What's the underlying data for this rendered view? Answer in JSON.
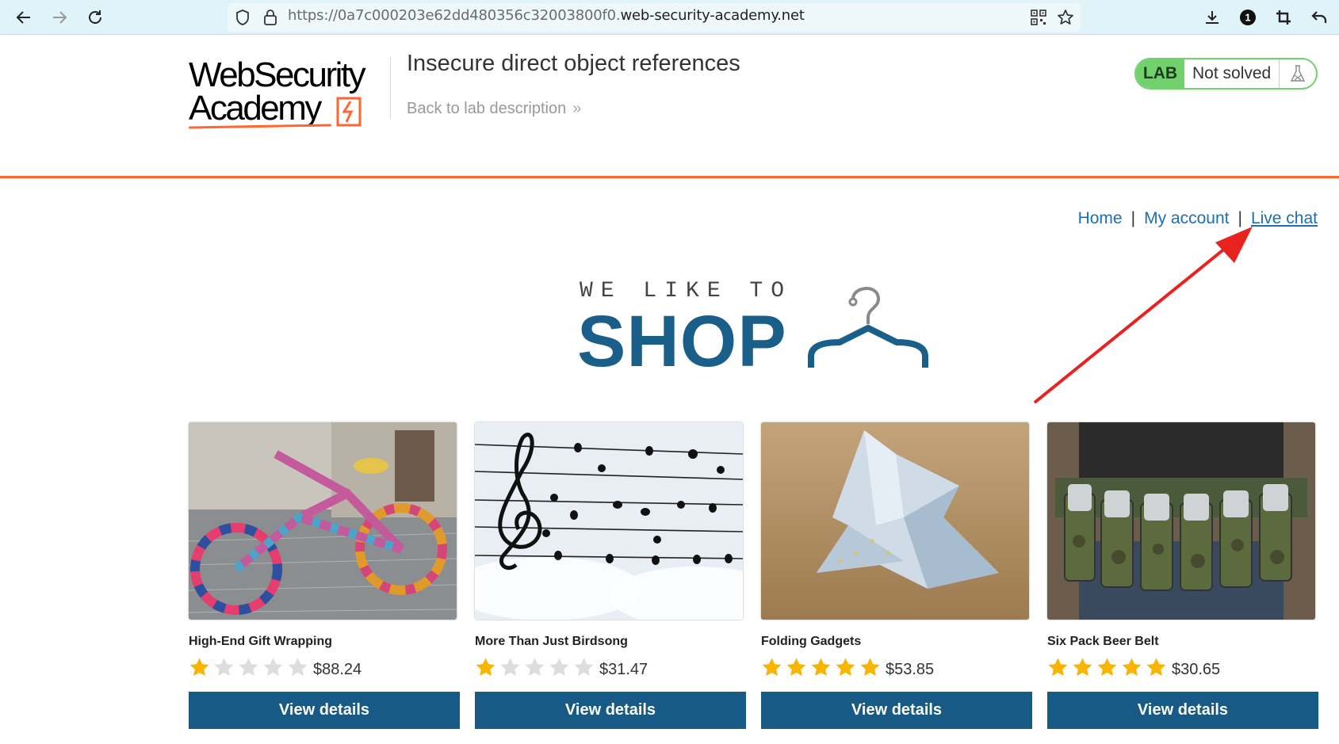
{
  "browser": {
    "url_prefix": "https://0a7c000203e62dd480356c32003800f0.",
    "url_domain": "web-security-academy.net",
    "notification_count": "1"
  },
  "header": {
    "logo_line1": "WebSecurity",
    "logo_line2": "Academy",
    "lab_title": "Insecure direct object references",
    "back_link": "Back to lab description",
    "lab_label": "LAB",
    "lab_status": "Not solved"
  },
  "nav": {
    "home": "Home",
    "my_account": "My account",
    "live_chat": "Live chat",
    "separator": "|"
  },
  "hero": {
    "tagline": "WE LIKE TO",
    "title": "SHOP"
  },
  "products": [
    {
      "name": "High-End Gift Wrapping",
      "rating": 1,
      "price": "$88.24",
      "button": "View details"
    },
    {
      "name": "More Than Just Birdsong",
      "rating": 1,
      "price": "$31.47",
      "button": "View details"
    },
    {
      "name": "Folding Gadgets",
      "rating": 5,
      "price": "$53.85",
      "button": "View details"
    },
    {
      "name": "Six Pack Beer Belt",
      "rating": 5,
      "price": "$30.65",
      "button": "View details"
    }
  ],
  "colors": {
    "accent_orange": "#ff6633",
    "brand_blue": "#195f8a",
    "button_blue": "#165a85",
    "link_blue": "#1a6fb5",
    "lab_green": "#70d16d",
    "star_gold": "#f7b500",
    "star_empty": "#dddddd",
    "annotation_red": "#e8231f"
  },
  "icons": {
    "back": "arrow-left-icon",
    "forward": "arrow-right-icon",
    "reload": "reload-icon",
    "shield": "shield-icon",
    "lock": "lock-icon",
    "qr": "qr-code-icon",
    "bookmark": "star-outline-icon",
    "download": "download-icon",
    "crop": "crop-icon",
    "undo": "undo-icon",
    "flask": "flask-icon",
    "hanger": "hanger-icon"
  }
}
